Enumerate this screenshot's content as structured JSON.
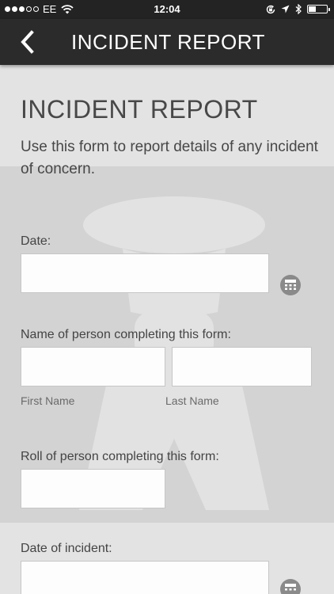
{
  "status_bar": {
    "carrier": "EE",
    "time": "12:04",
    "battery_level": 0.4,
    "icons": [
      "signal-dots-icon",
      "wifi-icon",
      "orientation-lock-icon",
      "location-icon",
      "bluetooth-icon",
      "battery-icon"
    ]
  },
  "nav": {
    "title": "INCIDENT REPORT",
    "back_icon": "chevron-left-icon"
  },
  "form": {
    "heading": "INCIDENT REPORT",
    "description": "Use this form to report details of any incident of concern.",
    "date": {
      "label": "Date:",
      "value": "",
      "icon": "calendar-icon"
    },
    "person_name": {
      "label": "Name of person completing this form:",
      "first_name": {
        "value": "",
        "sublabel": "First Name"
      },
      "last_name": {
        "value": "",
        "sublabel": "Last Name"
      }
    },
    "role": {
      "label": "Roll of person completing this form:",
      "value": ""
    },
    "incident_date": {
      "label": "Date of incident:",
      "value": "",
      "icon": "calendar-icon"
    }
  },
  "colors": {
    "nav_background": "#2b2b2b",
    "page_background": "#e3e3e3",
    "input_background": "#fdfdfd"
  }
}
